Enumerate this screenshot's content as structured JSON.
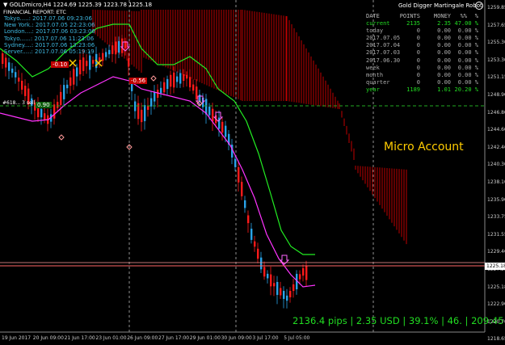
{
  "header": {
    "symbol_line": "▼ GOLDmicro,H4  1224.69 1225.39 1223.78 1225.18",
    "report_title": "FINANCIAL REPORT: ETC"
  },
  "sessions": [
    {
      "label": "Tokyo.....: 2017.07.06 09:23:06"
    },
    {
      "label": "New York.: 2017.07.05 22:23:06"
    },
    {
      "label": "London....: 2017.07.06 03:23:06"
    },
    {
      "label": "Tokyo......: 2017.07.06 11:23:06"
    },
    {
      "label": "Sydney....: 2017.07.06 13:23:06"
    },
    {
      "label": "Server.....: 2017.07.06 05:19:19"
    }
  ],
  "robot": {
    "title": "Gold Digger Martingale Robot",
    "icon": "smiley-icon"
  },
  "stats": {
    "headers": [
      "DATE",
      "POINTS",
      "MONEY",
      "%%",
      "%"
    ],
    "rows": [
      {
        "date": "current",
        "points": "2135",
        "money": "2.35",
        "pct": "47.00 %",
        "highlight": true
      },
      {
        "date": "today",
        "points": "0",
        "money": "0.00",
        "pct": "0.00 %"
      },
      {
        "date": "2017.07.05",
        "points": "0",
        "money": "0.00",
        "pct": "0.00 %"
      },
      {
        "date": "2017.07.04",
        "points": "0",
        "money": "0.00",
        "pct": "0.00 %"
      },
      {
        "date": "2017.07.03",
        "points": "0",
        "money": "0.00",
        "pct": "0.00 %"
      },
      {
        "date": "2017.06.30",
        "points": "0",
        "money": "0.00",
        "pct": "0.00 %"
      },
      {
        "date": "week",
        "points": "0",
        "money": "0.00",
        "pct": "0.00 %"
      },
      {
        "date": "month",
        "points": "0",
        "money": "0.00",
        "pct": "0.00 %"
      },
      {
        "date": "quarter",
        "points": "0",
        "money": "0.00",
        "pct": "0.00 %"
      },
      {
        "date": "year",
        "points": "1189",
        "money": "1.01",
        "pct": "20.20 %",
        "highlight": true
      }
    ]
  },
  "account_label": "Micro Account",
  "summary": "2136.4 pips | 2.35 USD | 39.1% | 46. | 209:45",
  "price_axis": [
    "1259.85",
    "1257.65",
    "1255.30",
    "1253.30",
    "1251.15",
    "1248.90",
    "1246.80",
    "1244.60",
    "1242.40",
    "1240.30",
    "1238.10",
    "1235.90",
    "1233.75",
    "1231.55",
    "1229.40",
    "1227.25",
    "1225.18",
    "1222.90",
    "1220.70",
    "1218.65"
  ],
  "current_price": "1225.18",
  "time_axis": [
    "19 Jun 2017",
    "20 Jun 09:00",
    "21 Jun 17:00",
    "23 Jun 01:00",
    "26 Jun 09:00",
    "27 Jun 17:00",
    "29 Jun 01:00",
    "30 Jun 09:00",
    "3 Jul 17:00",
    "5 Jul 05:00"
  ],
  "labels": {
    "trade1": "-0.10",
    "trade2": "-0.56",
    "trade3": "0.90",
    "order_line": "#618... 3 sell"
  },
  "colors": {
    "bull": "#29a3e8",
    "bear": "#ff1a1a",
    "cloud": "#c00000",
    "green_band": "#22ee22",
    "magenta_band": "#ff33ff",
    "order_line": "#22aa22",
    "price_line": "#ff6666",
    "text_green": "#22dd22",
    "text_yellow": "#ffcc00"
  }
}
